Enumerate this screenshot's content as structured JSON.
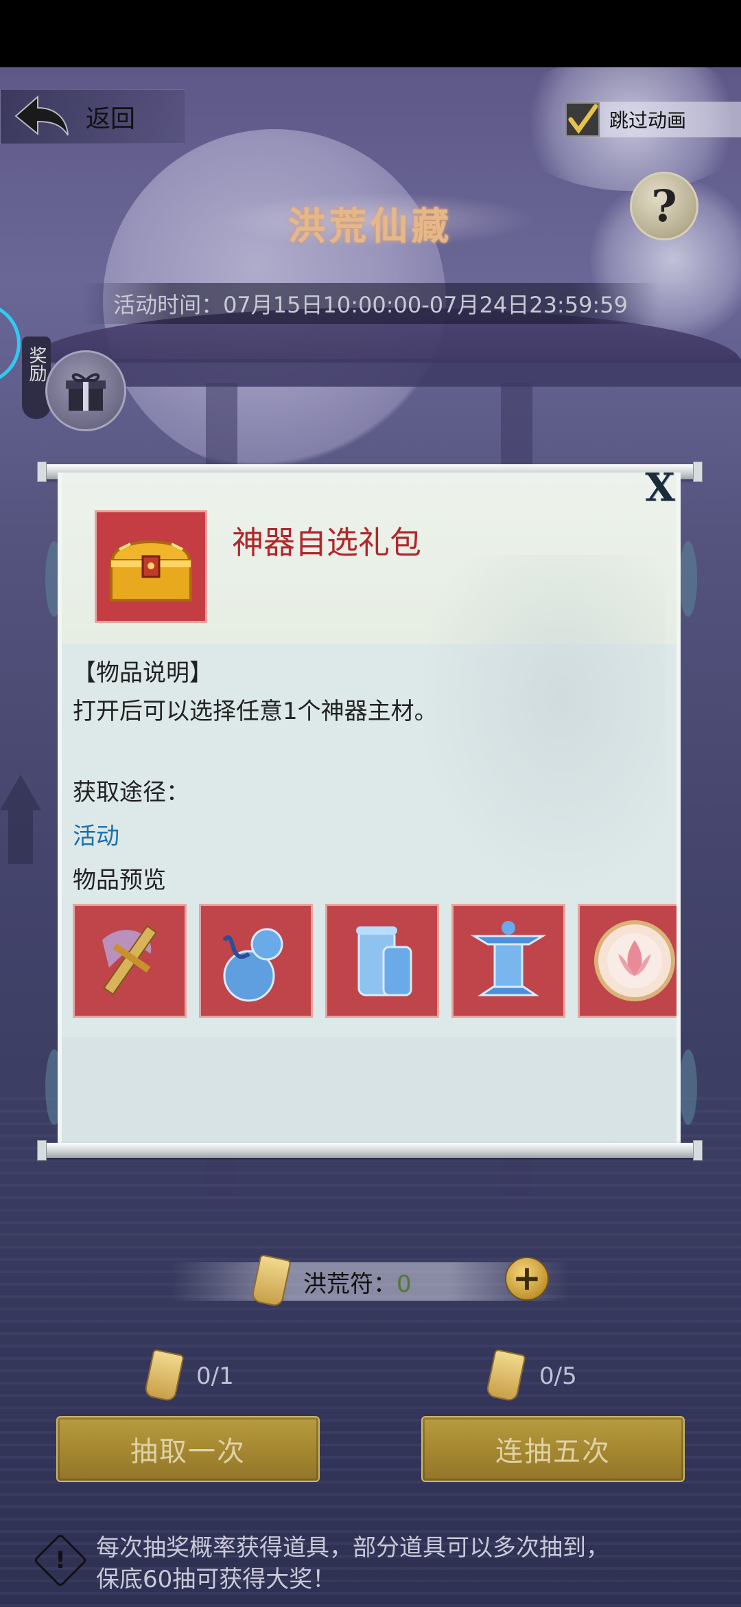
{
  "header": {
    "back_label": "返回",
    "skip_animation_label": "跳过动画",
    "skip_animation_checked": true,
    "help_label": "?"
  },
  "event": {
    "title": "洪荒仙藏",
    "time_text": "活动时间：07月15日10:00:00-07月24日23:59:59"
  },
  "side": {
    "reward_tab_label": "奖励"
  },
  "modal": {
    "close_label": "X",
    "item_name": "神器自选礼包",
    "description_heading": "【物品说明】",
    "description_text": "打开后可以选择任意1个神器主材。",
    "source_heading": "获取途径：",
    "source_link": "活动",
    "preview_heading": "物品预览",
    "preview_items": [
      {
        "icon": "golden-sword-icon"
      },
      {
        "icon": "blue-gourd-icon"
      },
      {
        "icon": "blue-scroll-icon"
      },
      {
        "icon": "blue-lantern-icon"
      },
      {
        "icon": "lotus-mirror-icon"
      }
    ]
  },
  "currency": {
    "label": "洪荒符：",
    "value": "0",
    "add_label": "+"
  },
  "draws": {
    "single": {
      "count": "0/1",
      "label": "抽取一次"
    },
    "five": {
      "count": "0/5",
      "label": "连抽五次"
    }
  },
  "notice": {
    "line1": "每次抽奖概率获得道具，部分道具可以多次抽到，",
    "line2": "保底60抽可获得大奖！"
  },
  "colors": {
    "item_name": "#b0272c",
    "link": "#1f6fa8",
    "draw_button": "#a58830",
    "title_glow": "#d98f5a"
  }
}
